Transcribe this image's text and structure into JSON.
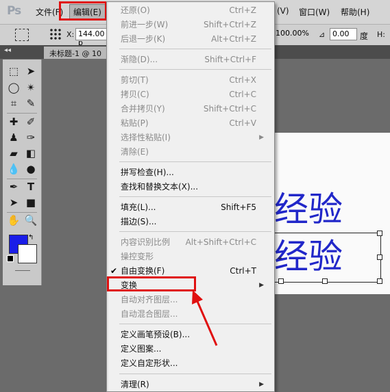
{
  "app": {
    "logo": "Ps"
  },
  "menubar": {
    "file": "文件(F)",
    "edit": "编辑(E)",
    "image_partial": "(V)",
    "window": "窗口(W)",
    "help": "帮助(H)"
  },
  "options": {
    "x_label": "X:",
    "x_value": "144.00 p",
    "scale_value": "100.00%",
    "angle_value": "0.00",
    "degree_label": "度",
    "h_label": "H:"
  },
  "document": {
    "tab": "未标题-1 @ 10"
  },
  "canvas": {
    "text_line1": "经验",
    "text_line2": "经验",
    "text_color": "#2127c9"
  },
  "colors": {
    "foreground": "#1a1de8",
    "background": "#ffffff",
    "highlight": "#e01010"
  },
  "edit_menu": [
    {
      "label": "还原(O)",
      "shortcut": "Ctrl+Z",
      "disabled": true
    },
    {
      "label": "前进一步(W)",
      "shortcut": "Shift+Ctrl+Z",
      "disabled": true
    },
    {
      "label": "后退一步(K)",
      "shortcut": "Alt+Ctrl+Z",
      "disabled": true
    },
    {
      "label": "渐隐(D)...",
      "shortcut": "Shift+Ctrl+F",
      "disabled": true
    },
    {
      "label": "剪切(T)",
      "shortcut": "Ctrl+X",
      "disabled": true
    },
    {
      "label": "拷贝(C)",
      "shortcut": "Ctrl+C",
      "disabled": true
    },
    {
      "label": "合并拷贝(Y)",
      "shortcut": "Shift+Ctrl+C",
      "disabled": true
    },
    {
      "label": "粘贴(P)",
      "shortcut": "Ctrl+V",
      "disabled": true
    },
    {
      "label": "选择性粘贴(I)",
      "shortcut": "",
      "disabled": true,
      "submenu": true
    },
    {
      "label": "清除(E)",
      "shortcut": "",
      "disabled": true
    },
    {
      "label": "拼写检查(H)...",
      "shortcut": "",
      "disabled": false
    },
    {
      "label": "查找和替换文本(X)...",
      "shortcut": "",
      "disabled": false
    },
    {
      "label": "填充(L)...",
      "shortcut": "Shift+F5",
      "disabled": false
    },
    {
      "label": "描边(S)...",
      "shortcut": "",
      "disabled": false
    },
    {
      "label": "内容识别比例",
      "shortcut": "Alt+Shift+Ctrl+C",
      "disabled": true
    },
    {
      "label": "操控变形",
      "shortcut": "",
      "disabled": true
    },
    {
      "label": "自由变换(F)",
      "shortcut": "Ctrl+T",
      "disabled": false,
      "checked": true
    },
    {
      "label": "变换",
      "shortcut": "",
      "disabled": false,
      "submenu": true,
      "highlighted": true
    },
    {
      "label": "自动对齐图层...",
      "shortcut": "",
      "disabled": true
    },
    {
      "label": "自动混合图层...",
      "shortcut": "",
      "disabled": true
    },
    {
      "label": "定义画笔预设(B)...",
      "shortcut": "",
      "disabled": false
    },
    {
      "label": "定义图案...",
      "shortcut": "",
      "disabled": false
    },
    {
      "label": "定义自定形状...",
      "shortcut": "",
      "disabled": false
    },
    {
      "label": "清理(R)",
      "shortcut": "",
      "disabled": false,
      "submenu": true
    }
  ]
}
